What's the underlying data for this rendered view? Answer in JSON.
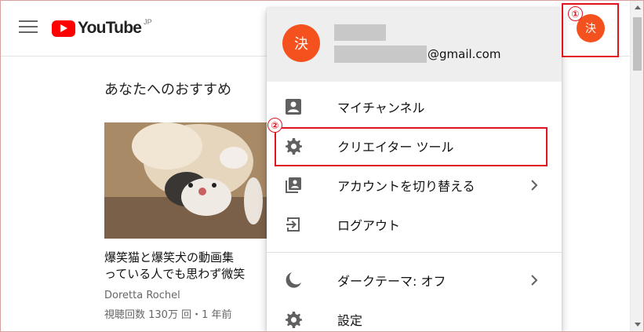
{
  "header": {
    "logo_text": "YouTube",
    "logo_region": "JP"
  },
  "main": {
    "section_title": "あなたへのおすすめ",
    "video": {
      "title": "爆笑猫と爆笑犬の動画集\nっている人でも思わず微笑",
      "channel": "Doretta Rochel",
      "meta": "視聴回数 130万 回・1 年前"
    }
  },
  "account": {
    "avatar_char": "決",
    "email_suffix": "@gmail.com"
  },
  "menu": {
    "items": [
      {
        "label": "マイチャンネル",
        "icon": "account-box-icon"
      },
      {
        "label": "クリエイター ツール",
        "icon": "gear-icon"
      },
      {
        "label": "アカウントを切り替える",
        "icon": "switch-account-icon"
      },
      {
        "label": "ログアウト",
        "icon": "logout-icon"
      },
      {
        "label": "ダークテーマ: オフ",
        "icon": "moon-icon"
      },
      {
        "label": "設定",
        "icon": "gear-icon"
      }
    ]
  },
  "annotations": {
    "marker_1": "①",
    "marker_2": "②"
  },
  "colors": {
    "accent": "#f4511e",
    "youtube_red": "#ff0000",
    "annotation_red": "#e0141e"
  }
}
